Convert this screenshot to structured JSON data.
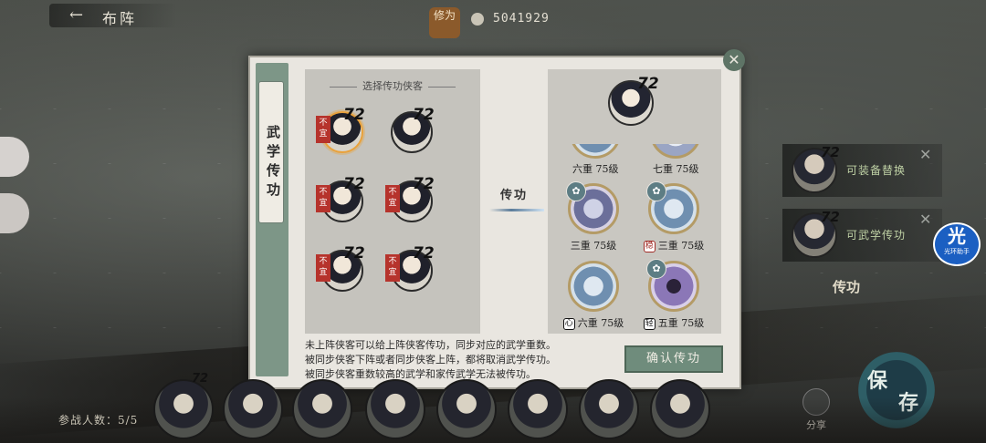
{
  "top": {
    "back_arrow": "←",
    "screen_title": "布阵",
    "power_seal": "修为",
    "power_value": "5041929"
  },
  "dialog": {
    "tab_label": "武学传功",
    "close_symbol": "✕",
    "left_header": "选择传功侠客",
    "heroes": [
      {
        "level": "72",
        "tag": "不宜",
        "selected": true
      },
      {
        "level": "72",
        "tag": ""
      },
      {
        "level": "72",
        "tag": "不宜"
      },
      {
        "level": "72",
        "tag": "不宜"
      },
      {
        "level": "72",
        "tag": "不宜"
      },
      {
        "level": "72",
        "tag": "不宜"
      }
    ],
    "transfer_label": "传功",
    "target": {
      "level": "72"
    },
    "skills_top": [
      {
        "caption": "六重 75级"
      },
      {
        "caption": "七重 75级"
      }
    ],
    "skills": [
      {
        "caption": "三重 75级",
        "mark": ""
      },
      {
        "caption": "三重 75级",
        "mark": "稳"
      },
      {
        "caption": "六重 75级",
        "mark": "心"
      },
      {
        "caption": "五重 75级",
        "mark": "轻"
      }
    ],
    "description": [
      "未上阵侠客可以给上阵侠客传功，同步对应的武学重数。",
      "被同步侠客下阵或者同步侠客上阵，都将取消武学传功。",
      "被同步侠客重数较高的武学和家传武学无法被传功。"
    ],
    "confirm_label": "确认传功"
  },
  "side": {
    "panels": [
      {
        "level": "72",
        "text": "可装备替换"
      },
      {
        "level": "72",
        "text": "可武学传功"
      }
    ],
    "close_symbol": "✕",
    "assist_big": "光",
    "assist_small": "光环助手",
    "chuan_label": "传功",
    "save_a": "保",
    "save_b": "存",
    "share_label": "分享"
  },
  "bottom": {
    "count_label": "参战人数：5/5",
    "slot_level": "72"
  }
}
